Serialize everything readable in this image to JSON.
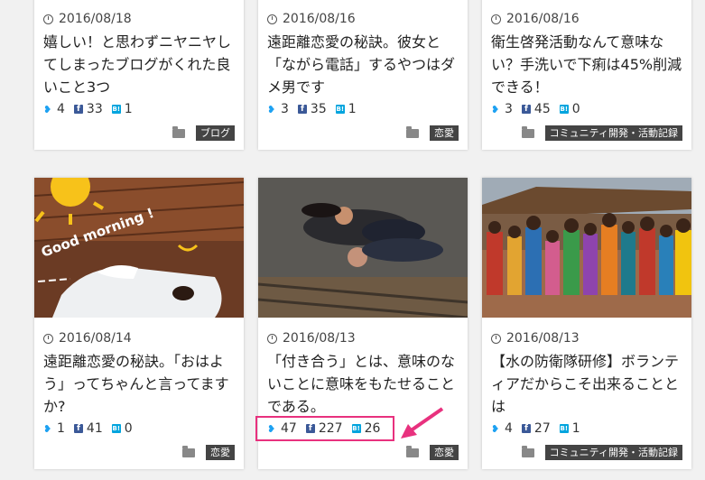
{
  "cards": [
    {
      "date": "2016/08/18",
      "title": "嬉しい！と思わずニヤニヤしてしまったブログがくれた良いこと3つ",
      "tw": "4",
      "fb": "33",
      "hb": "1",
      "tag": "ブログ"
    },
    {
      "date": "2016/08/16",
      "title": "遠距離恋愛の秘訣。彼女と「ながら電話」するやつはダメ男です",
      "tw": "3",
      "fb": "35",
      "hb": "1",
      "tag": "恋愛"
    },
    {
      "date": "2016/08/16",
      "title": "衛生啓発活動なんて意味ない？手洗いで下痢は45%削減できる！",
      "tw": "3",
      "fb": "45",
      "hb": "0",
      "tag": "コミュニティ開発・活動記録"
    },
    {
      "date": "2016/08/14",
      "title": "遠距離恋愛の秘訣。「おはよう」ってちゃんと言ってますか?",
      "tw": "1",
      "fb": "41",
      "hb": "0",
      "tag": "恋愛",
      "image_text": "Good morning !"
    },
    {
      "date": "2016/08/13",
      "title": "「付き合う」とは、意味のないことに意味をもたせることである。",
      "tw": "47",
      "fb": "227",
      "hb": "26",
      "tag": "恋愛"
    },
    {
      "date": "2016/08/13",
      "title": "【水の防衛隊研修】ボランティアだからこそ出来ることとは",
      "tw": "4",
      "fb": "27",
      "hb": "1",
      "tag": "コミュニティ開発・活動記録"
    }
  ],
  "icons": {
    "twitter": "twitter-icon",
    "facebook": "facebook-icon",
    "hatena": "hatena-bookmark-icon",
    "clock": "clock-icon",
    "folder": "folder-icon"
  },
  "icon_glyphs": {
    "twitter": "❥",
    "facebook": "f",
    "hatena": "B!"
  },
  "colors": {
    "twitter": "#1da1f2",
    "facebook": "#3b5998",
    "hatena": "#00a4de",
    "highlight": "#e8317e",
    "tag_bg": "#444444"
  }
}
